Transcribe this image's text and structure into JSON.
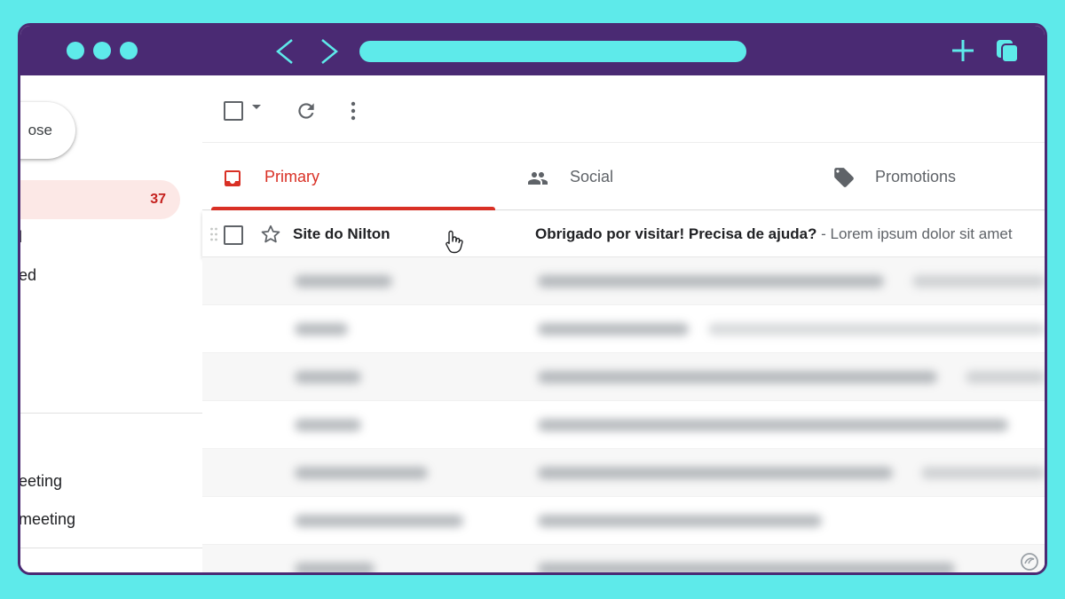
{
  "colors": {
    "frame": "#4a2a73",
    "background": "#5eeaea",
    "accent_red": "#d93025",
    "inbox_highlight": "#fce8e6"
  },
  "browser": {
    "dots": [
      "dot",
      "dot",
      "dot"
    ],
    "back_glyph": "‹",
    "forward_glyph": "›",
    "new_tab_glyph": "+",
    "icons": [
      "back-arrow-icon",
      "forward-arrow-icon",
      "plus-icon",
      "copy-icon"
    ]
  },
  "sidebar": {
    "compose_label": "ose",
    "inbox_count": "37",
    "fragment_1": "l",
    "fragment_2": "ed",
    "label_1": "eeting",
    "label_2": "meeting"
  },
  "toolbar": {
    "icons": [
      "select-checkbox",
      "caret-down-icon",
      "refresh-icon",
      "more-vert-icon"
    ]
  },
  "tabs": [
    {
      "label": "Primary",
      "icon": "inbox-icon",
      "selected": true
    },
    {
      "label": "Social",
      "icon": "people-icon",
      "selected": false
    },
    {
      "label": "Promotions",
      "icon": "tag-icon",
      "selected": false
    }
  ],
  "email": {
    "sender": "Site do Nilton",
    "subject": "Obrigado por visitar! Precisa de ajuda?",
    "snippet": " - Lorem ipsum dolor sit amet"
  },
  "blurred_rows": 7
}
